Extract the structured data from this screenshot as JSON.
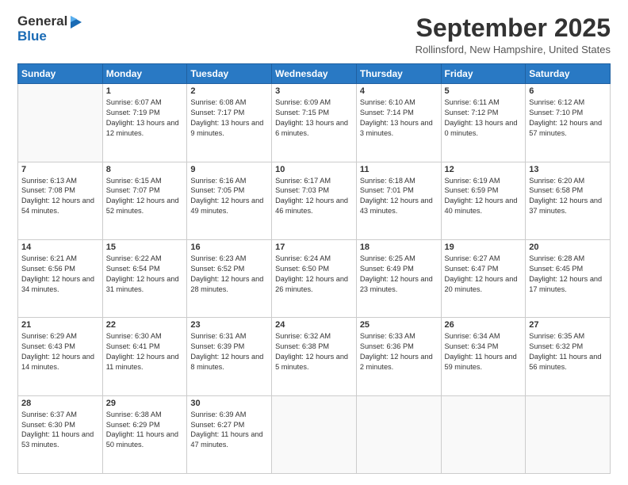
{
  "header": {
    "logo_general": "General",
    "logo_blue": "Blue",
    "month_title": "September 2025",
    "location": "Rollinsford, New Hampshire, United States"
  },
  "days_of_week": [
    "Sunday",
    "Monday",
    "Tuesday",
    "Wednesday",
    "Thursday",
    "Friday",
    "Saturday"
  ],
  "weeks": [
    [
      {
        "day": "",
        "sunrise": "",
        "sunset": "",
        "daylight": ""
      },
      {
        "day": "1",
        "sunrise": "Sunrise: 6:07 AM",
        "sunset": "Sunset: 7:19 PM",
        "daylight": "Daylight: 13 hours and 12 minutes."
      },
      {
        "day": "2",
        "sunrise": "Sunrise: 6:08 AM",
        "sunset": "Sunset: 7:17 PM",
        "daylight": "Daylight: 13 hours and 9 minutes."
      },
      {
        "day": "3",
        "sunrise": "Sunrise: 6:09 AM",
        "sunset": "Sunset: 7:15 PM",
        "daylight": "Daylight: 13 hours and 6 minutes."
      },
      {
        "day": "4",
        "sunrise": "Sunrise: 6:10 AM",
        "sunset": "Sunset: 7:14 PM",
        "daylight": "Daylight: 13 hours and 3 minutes."
      },
      {
        "day": "5",
        "sunrise": "Sunrise: 6:11 AM",
        "sunset": "Sunset: 7:12 PM",
        "daylight": "Daylight: 13 hours and 0 minutes."
      },
      {
        "day": "6",
        "sunrise": "Sunrise: 6:12 AM",
        "sunset": "Sunset: 7:10 PM",
        "daylight": "Daylight: 12 hours and 57 minutes."
      }
    ],
    [
      {
        "day": "7",
        "sunrise": "Sunrise: 6:13 AM",
        "sunset": "Sunset: 7:08 PM",
        "daylight": "Daylight: 12 hours and 54 minutes."
      },
      {
        "day": "8",
        "sunrise": "Sunrise: 6:15 AM",
        "sunset": "Sunset: 7:07 PM",
        "daylight": "Daylight: 12 hours and 52 minutes."
      },
      {
        "day": "9",
        "sunrise": "Sunrise: 6:16 AM",
        "sunset": "Sunset: 7:05 PM",
        "daylight": "Daylight: 12 hours and 49 minutes."
      },
      {
        "day": "10",
        "sunrise": "Sunrise: 6:17 AM",
        "sunset": "Sunset: 7:03 PM",
        "daylight": "Daylight: 12 hours and 46 minutes."
      },
      {
        "day": "11",
        "sunrise": "Sunrise: 6:18 AM",
        "sunset": "Sunset: 7:01 PM",
        "daylight": "Daylight: 12 hours and 43 minutes."
      },
      {
        "day": "12",
        "sunrise": "Sunrise: 6:19 AM",
        "sunset": "Sunset: 6:59 PM",
        "daylight": "Daylight: 12 hours and 40 minutes."
      },
      {
        "day": "13",
        "sunrise": "Sunrise: 6:20 AM",
        "sunset": "Sunset: 6:58 PM",
        "daylight": "Daylight: 12 hours and 37 minutes."
      }
    ],
    [
      {
        "day": "14",
        "sunrise": "Sunrise: 6:21 AM",
        "sunset": "Sunset: 6:56 PM",
        "daylight": "Daylight: 12 hours and 34 minutes."
      },
      {
        "day": "15",
        "sunrise": "Sunrise: 6:22 AM",
        "sunset": "Sunset: 6:54 PM",
        "daylight": "Daylight: 12 hours and 31 minutes."
      },
      {
        "day": "16",
        "sunrise": "Sunrise: 6:23 AM",
        "sunset": "Sunset: 6:52 PM",
        "daylight": "Daylight: 12 hours and 28 minutes."
      },
      {
        "day": "17",
        "sunrise": "Sunrise: 6:24 AM",
        "sunset": "Sunset: 6:50 PM",
        "daylight": "Daylight: 12 hours and 26 minutes."
      },
      {
        "day": "18",
        "sunrise": "Sunrise: 6:25 AM",
        "sunset": "Sunset: 6:49 PM",
        "daylight": "Daylight: 12 hours and 23 minutes."
      },
      {
        "day": "19",
        "sunrise": "Sunrise: 6:27 AM",
        "sunset": "Sunset: 6:47 PM",
        "daylight": "Daylight: 12 hours and 20 minutes."
      },
      {
        "day": "20",
        "sunrise": "Sunrise: 6:28 AM",
        "sunset": "Sunset: 6:45 PM",
        "daylight": "Daylight: 12 hours and 17 minutes."
      }
    ],
    [
      {
        "day": "21",
        "sunrise": "Sunrise: 6:29 AM",
        "sunset": "Sunset: 6:43 PM",
        "daylight": "Daylight: 12 hours and 14 minutes."
      },
      {
        "day": "22",
        "sunrise": "Sunrise: 6:30 AM",
        "sunset": "Sunset: 6:41 PM",
        "daylight": "Daylight: 12 hours and 11 minutes."
      },
      {
        "day": "23",
        "sunrise": "Sunrise: 6:31 AM",
        "sunset": "Sunset: 6:39 PM",
        "daylight": "Daylight: 12 hours and 8 minutes."
      },
      {
        "day": "24",
        "sunrise": "Sunrise: 6:32 AM",
        "sunset": "Sunset: 6:38 PM",
        "daylight": "Daylight: 12 hours and 5 minutes."
      },
      {
        "day": "25",
        "sunrise": "Sunrise: 6:33 AM",
        "sunset": "Sunset: 6:36 PM",
        "daylight": "Daylight: 12 hours and 2 minutes."
      },
      {
        "day": "26",
        "sunrise": "Sunrise: 6:34 AM",
        "sunset": "Sunset: 6:34 PM",
        "daylight": "Daylight: 11 hours and 59 minutes."
      },
      {
        "day": "27",
        "sunrise": "Sunrise: 6:35 AM",
        "sunset": "Sunset: 6:32 PM",
        "daylight": "Daylight: 11 hours and 56 minutes."
      }
    ],
    [
      {
        "day": "28",
        "sunrise": "Sunrise: 6:37 AM",
        "sunset": "Sunset: 6:30 PM",
        "daylight": "Daylight: 11 hours and 53 minutes."
      },
      {
        "day": "29",
        "sunrise": "Sunrise: 6:38 AM",
        "sunset": "Sunset: 6:29 PM",
        "daylight": "Daylight: 11 hours and 50 minutes."
      },
      {
        "day": "30",
        "sunrise": "Sunrise: 6:39 AM",
        "sunset": "Sunset: 6:27 PM",
        "daylight": "Daylight: 11 hours and 47 minutes."
      },
      {
        "day": "",
        "sunrise": "",
        "sunset": "",
        "daylight": ""
      },
      {
        "day": "",
        "sunrise": "",
        "sunset": "",
        "daylight": ""
      },
      {
        "day": "",
        "sunrise": "",
        "sunset": "",
        "daylight": ""
      },
      {
        "day": "",
        "sunrise": "",
        "sunset": "",
        "daylight": ""
      }
    ]
  ]
}
